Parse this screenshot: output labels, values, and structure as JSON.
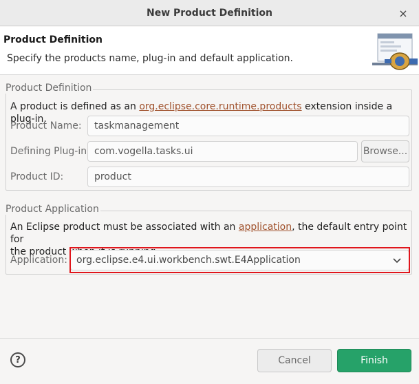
{
  "window": {
    "title": "New Product Definition",
    "close_glyph": "×"
  },
  "header": {
    "title": "Product Definition",
    "description": "Specify the products name, plug-in and default application.",
    "icon": "wizard-banner-icon"
  },
  "product_definition_group": {
    "legend": "Product Definition",
    "desc_prefix": "A product is defined as an ",
    "desc_link": "org.eclipse.core.runtime.products",
    "desc_suffix": " extension inside a plug-in.",
    "product_name_label": "Product Name:",
    "product_name_value": "taskmanagement",
    "defining_plugin_label": "Defining Plug-in:",
    "defining_plugin_value": "com.vogella.tasks.ui",
    "browse_label": "Browse...",
    "product_id_label": "Product ID:",
    "product_id_value": "product"
  },
  "product_application_group": {
    "legend": "Product Application",
    "desc_prefix": "An Eclipse product must be associated with an ",
    "desc_link": "application",
    "desc_suffix": ", the default entry point for",
    "desc_line2": "the product when it is running.",
    "application_label": "Application:",
    "application_value": "org.eclipse.e4.ui.workbench.swt.E4Application"
  },
  "footer": {
    "help_glyph": "?",
    "cancel_label": "Cancel",
    "finish_label": "Finish"
  },
  "colors": {
    "accent_finish": "#26a269",
    "link": "#a0522d",
    "highlight": "#e0151b"
  }
}
